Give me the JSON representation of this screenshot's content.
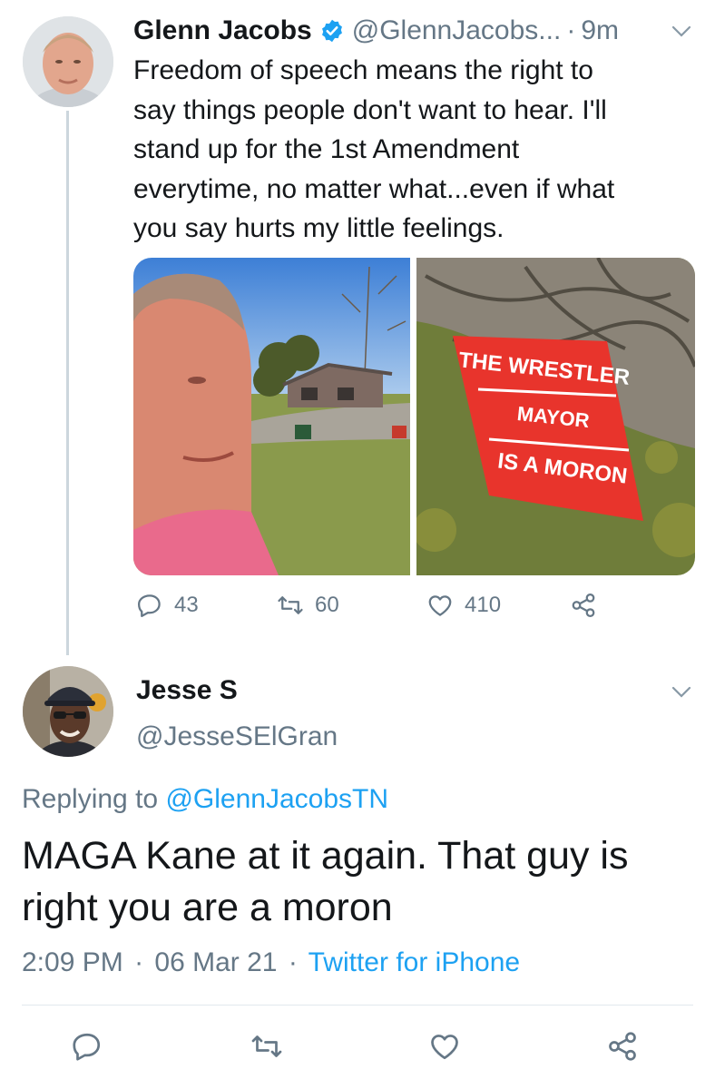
{
  "thread": {
    "original_tweet": {
      "author_name": "Glenn Jacobs",
      "handle": "@GlennJacobs...",
      "separator": "·",
      "time_ago": "9m",
      "text_lines": [
        "Freedom of speech means the right to",
        "say things people don't want to hear. I'll",
        "stand up for the 1st Amendment",
        "everytime, no matter what...even if what",
        "you say hurts my little feelings."
      ],
      "sign": {
        "line1": "THE WRESTLER",
        "line2": "MAYOR",
        "line3": "IS A MORON"
      },
      "actions": {
        "replies": "43",
        "retweets": "60",
        "likes": "410"
      }
    },
    "reply_tweet": {
      "author_name": "Jesse S",
      "handle": "@JesseSElGran",
      "replying_to_prefix": "Replying to ",
      "replying_to_handle": "@GlennJacobsTN",
      "text_lines": [
        "MAGA Kane at it again. That guy is",
        "right you are a moron"
      ],
      "time": "2:09 PM",
      "separator": "·",
      "date": "06 Mar 21",
      "source": "Twitter for iPhone"
    }
  },
  "icons": {
    "verified": "verified-badge-icon",
    "reply": "reply-icon",
    "retweet": "retweet-icon",
    "like": "heart-icon",
    "share": "share-icon",
    "caret": "chevron-down-icon"
  },
  "colors": {
    "text": "#14171a",
    "muted": "#657786",
    "accent": "#1da1f2",
    "thread_line": "#ccd6dd",
    "sign_red": "#e8342c"
  }
}
